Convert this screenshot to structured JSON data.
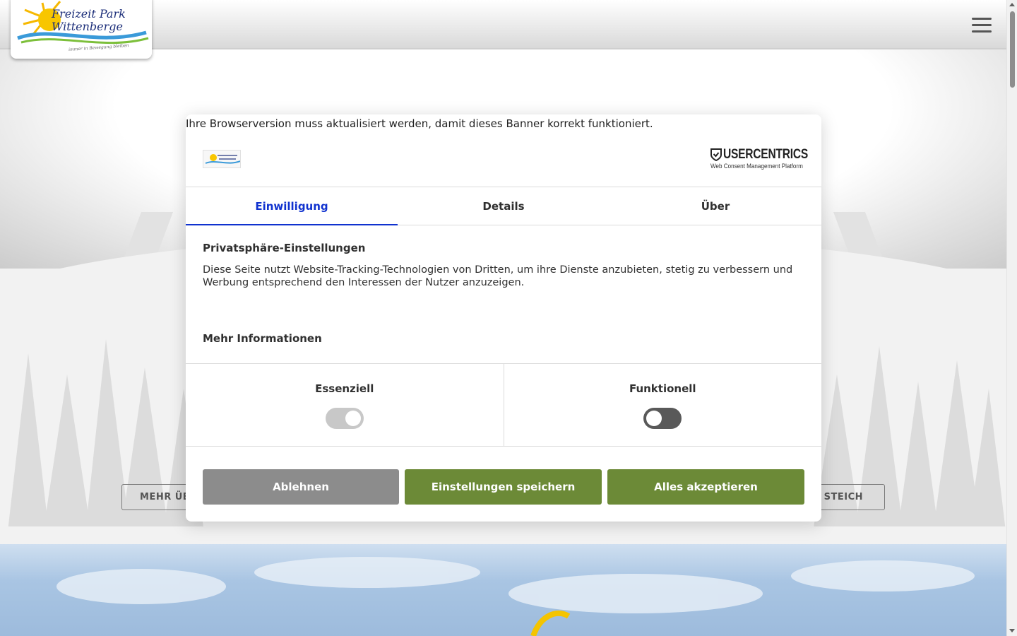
{
  "site": {
    "logo_text_line1": "Freizeit Park",
    "logo_text_line2": "Wittenberge",
    "logo_tagline": "immer in Bewegung bleiben",
    "left_button_label": "MEHR ÜB",
    "right_button_label": "STEICH"
  },
  "consent": {
    "browser_warning": "Ihre Browserversion muss aktualisiert werden, damit dieses Banner korrekt funktioniert.",
    "brand_name": "USERCENTRICS",
    "brand_subtitle": "Web Consent Management Platform",
    "tabs": [
      {
        "label": "Einwilligung",
        "active": true
      },
      {
        "label": "Details",
        "active": false
      },
      {
        "label": "Über",
        "active": false
      }
    ],
    "title": "Privatsphäre-Einstellungen",
    "description": "Diese Seite nutzt Website-Tracking-Technologien von Dritten, um ihre Dienste anzubieten, stetig zu verbessern und Werbung entsprechend den Interessen der Nutzer anzuzeigen.",
    "more_info": "Mehr Informationen",
    "categories": [
      {
        "label": "Essenziell",
        "enabled": true,
        "locked": true
      },
      {
        "label": "Funktionell",
        "enabled": false,
        "locked": false
      }
    ],
    "buttons": {
      "deny": "Ablehnen",
      "save": "Einstellungen speichern",
      "accept": "Alles akzeptieren"
    }
  },
  "colors": {
    "accent": "#1032cf",
    "primary_button": "#6c8a37",
    "secondary_button": "#8c8c8c"
  },
  "icons": [
    "menu-icon",
    "usercentrics-shield-icon",
    "sun-logo-icon"
  ]
}
